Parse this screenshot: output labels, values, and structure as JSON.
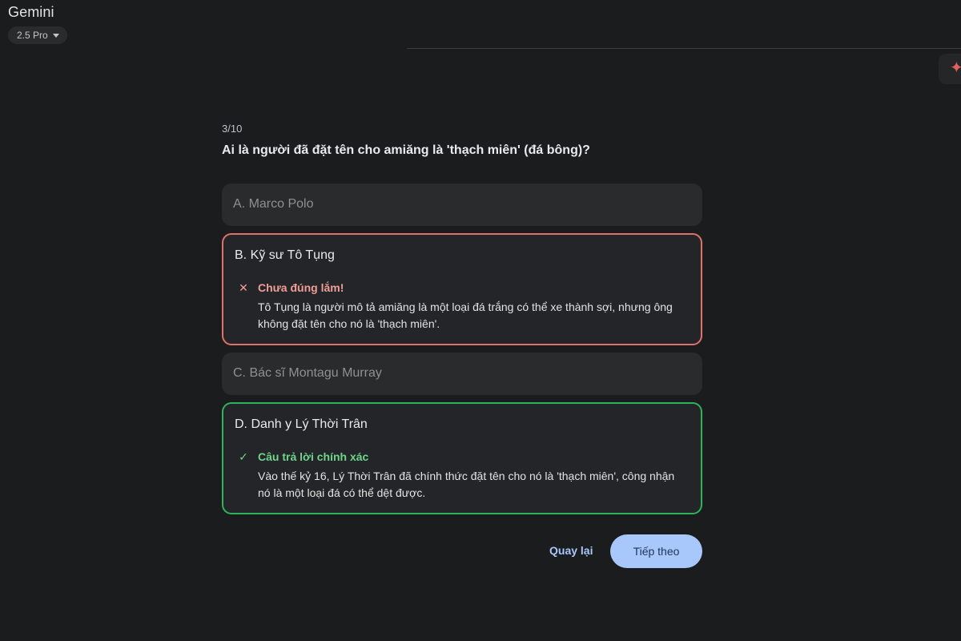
{
  "app": {
    "title": "Gemini",
    "model": "2.5 Pro"
  },
  "quiz": {
    "progress": "3/10",
    "question": "Ai là người đã đặt tên cho amiăng là 'thạch miên' (đá bông)?",
    "options": [
      {
        "letter": "A.",
        "text": "Marco Polo"
      },
      {
        "letter": "B.",
        "text": "Kỹ sư Tô Tụng",
        "feedback": {
          "title": "Chưa đúng lắm!",
          "text": "Tô Tụng là người mô tả amiăng là một loại đá trắng có thể xe thành sợi, nhưng ông không đặt tên cho nó là 'thạch miên'."
        }
      },
      {
        "letter": "C.",
        "text": "Bác sĩ Montagu Murray"
      },
      {
        "letter": "D.",
        "text": "Danh y Lý Thời Trân",
        "feedback": {
          "title": "Câu trả lời chính xác",
          "text": "Vào thế kỷ 16, Lý Thời Trân đã chính thức đặt tên cho nó là 'thạch miên', công nhận nó là một loại đá có thể dệt được."
        }
      }
    ],
    "back_label": "Quay lại",
    "next_label": "Tiếp theo"
  },
  "icons": {
    "spark": "sparkle-icon",
    "wrong": "close-icon",
    "right": "check-icon",
    "caret": "caret-down-icon"
  },
  "colors": {
    "wrong": "#e0716b",
    "right": "#2fb35a",
    "primary": "#a8c7fa"
  }
}
